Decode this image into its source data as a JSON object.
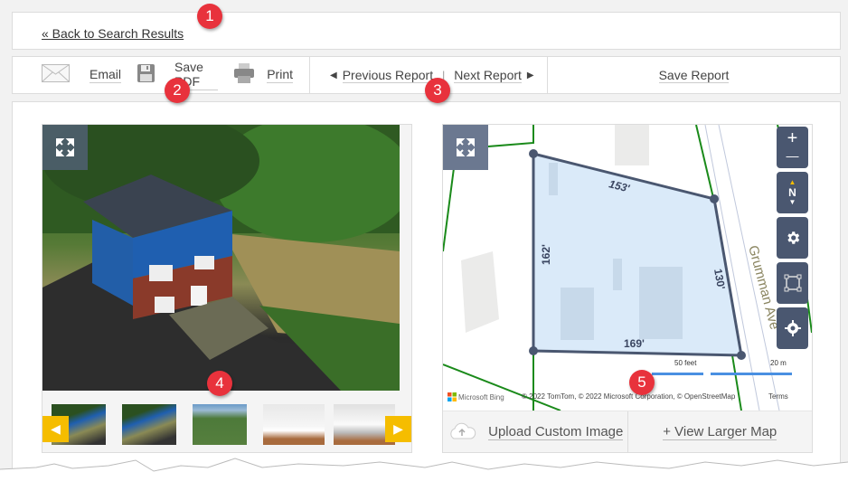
{
  "nav": {
    "back_link": "« Back to Search Results"
  },
  "toolbar": {
    "email": "Email",
    "save_pdf": "Save PDF",
    "print": "Print",
    "previous_report": "Previous Report",
    "separator": "|",
    "next_report": "Next Report",
    "save_report": "Save Report"
  },
  "gallery": {
    "thumbnails": [
      "house-aerial-front",
      "house-aerial-side",
      "neighborhood-aerial",
      "kitchen-1",
      "kitchen-2"
    ],
    "prev_icon": "◀",
    "next_icon": "▶",
    "accent_color": "#f5bd00"
  },
  "map": {
    "parcel_dimensions": {
      "top": "153'",
      "left": "162'",
      "right": "130'",
      "bottom": "169'"
    },
    "street_label": "Grumman Ave",
    "scale_feet": "50 feet",
    "scale_meters": "20 m",
    "attribution_logo": "Microsoft Bing",
    "attribution_text": "© 2022 TomTom, © 2022 Microsoft Corporation, © OpenStreetMap",
    "terms": "Terms",
    "controls": {
      "zoom_in": "+",
      "zoom_out": "—",
      "compass": "N"
    },
    "upload_button": "Upload Custom Image",
    "larger_map_button": "+ View Larger Map"
  },
  "annotations": [
    "1",
    "2",
    "3",
    "4",
    "5"
  ],
  "colors": {
    "badge": "#e8323c",
    "parcel_fill": "#d6e8f8",
    "parcel_stroke": "#4a5770",
    "property_lines": "#1a8a1a",
    "control_bg": "#4a5770"
  }
}
